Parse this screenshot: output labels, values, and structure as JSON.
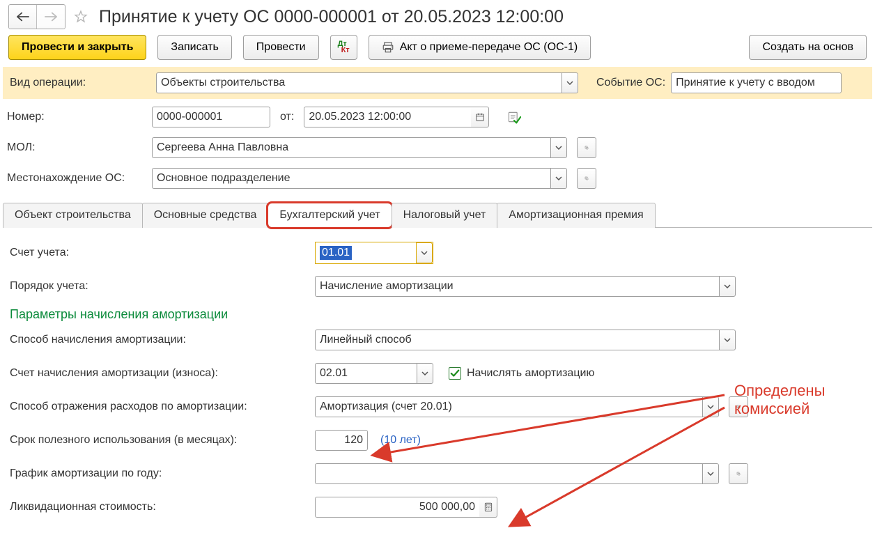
{
  "title": "Принятие к учету ОС 0000-000001 от 20.05.2023 12:00:00",
  "toolbar": {
    "post_close": "Провести и закрыть",
    "write": "Записать",
    "post": "Провести",
    "print_act": "Акт о приеме-передаче ОС (ОС-1)",
    "create_based": "Создать на основ"
  },
  "filter": {
    "op_type_label": "Вид операции:",
    "op_type_value": "Объекты строительства",
    "event_label": "Событие ОС:",
    "event_value": "Принятие к учету с вводом"
  },
  "header": {
    "number_label": "Номер:",
    "number_value": "0000-000001",
    "date_label": "от:",
    "date_value": "20.05.2023 12:00:00",
    "mol_label": "МОЛ:",
    "mol_value": "Сергеева Анна Павловна",
    "location_label": "Местонахождение ОС:",
    "location_value": "Основное подразделение"
  },
  "tabs": [
    {
      "label": "Объект строительства"
    },
    {
      "label": "Основные средства"
    },
    {
      "label": "Бухгалтерский учет"
    },
    {
      "label": "Налоговый учет"
    },
    {
      "label": "Амортизационная премия"
    }
  ],
  "accounting": {
    "account_label": "Счет учета:",
    "account_value": "01.01",
    "order_label": "Порядок учета:",
    "order_value": "Начисление амортизации",
    "section_title": "Параметры начисления амортизации",
    "method_label": "Способ начисления амортизации:",
    "method_value": "Линейный способ",
    "depr_account_label": "Счет начисления амортизации (износа):",
    "depr_account_value": "02.01",
    "do_depr_label": "Начислять амортизацию",
    "expense_label": "Способ отражения расходов по амортизации:",
    "expense_value": "Амортизация (счет 20.01)",
    "life_label": "Срок полезного использования (в месяцах):",
    "life_value": "120",
    "life_hint": "(10 лет)",
    "schedule_label": "График амортизации по году:",
    "schedule_value": "",
    "salvage_label": "Ликвидационная стоимость:",
    "salvage_value": "500 000,00"
  },
  "annotation": "Определены комиссией"
}
